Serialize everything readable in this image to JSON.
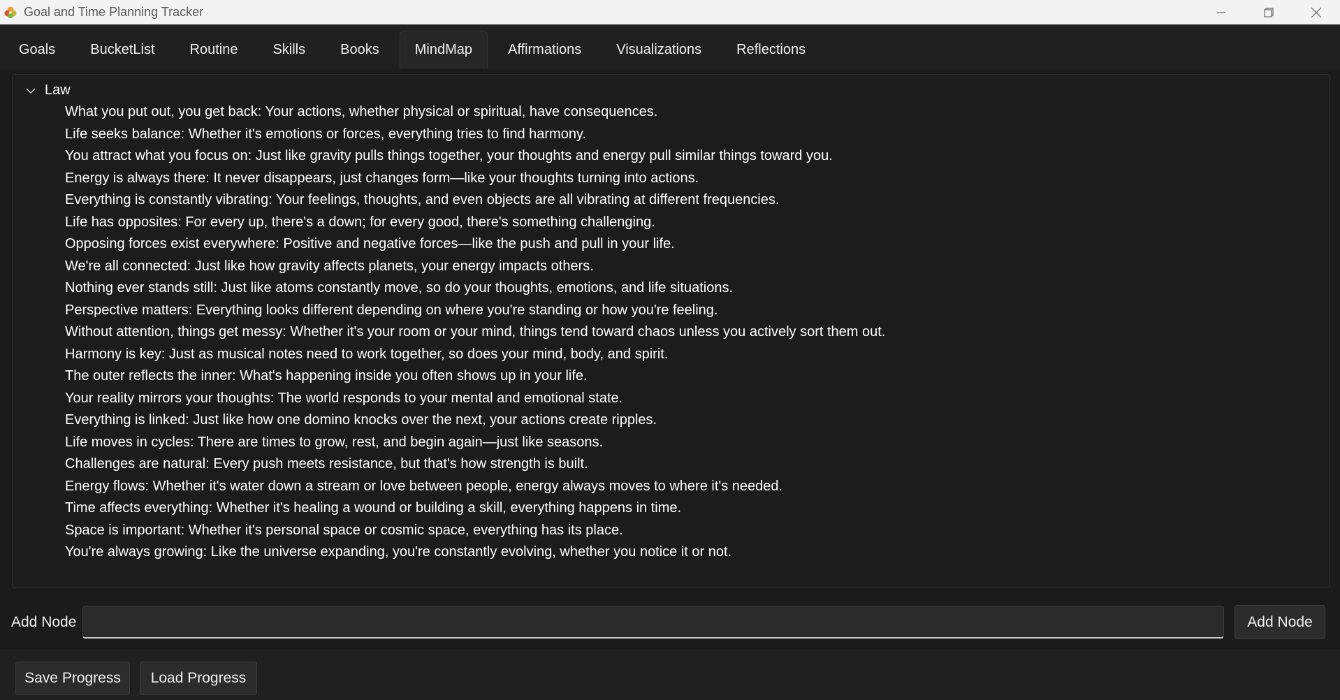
{
  "window": {
    "title": "Goal and Time Planning Tracker",
    "app_icon": "flower-logo-icon",
    "controls": [
      "minimize-icon",
      "restore-icon",
      "close-icon"
    ]
  },
  "tabs": [
    {
      "label": "Goals",
      "active": false
    },
    {
      "label": "BucketList",
      "active": false
    },
    {
      "label": "Routine",
      "active": false
    },
    {
      "label": "Skills",
      "active": false
    },
    {
      "label": "Books",
      "active": false
    },
    {
      "label": "MindMap",
      "active": true
    },
    {
      "label": "Affirmations",
      "active": false
    },
    {
      "label": "Visualizations",
      "active": false
    },
    {
      "label": "Reflections",
      "active": false
    }
  ],
  "mindmap": {
    "root": {
      "label": "Law",
      "expanded": true,
      "children": [
        "What you put out, you get back: Your actions, whether physical or spiritual, have consequences.",
        "Life seeks balance: Whether it's emotions or forces, everything tries to find harmony.",
        "You attract what you focus on: Just like gravity pulls things together, your thoughts and energy pull similar things toward you.",
        "Energy is always there: It never disappears, just changes form—like your thoughts turning into actions.",
        "Everything is constantly vibrating: Your feelings, thoughts, and even objects are all vibrating at different frequencies.",
        "Life has opposites: For every up, there's a down; for every good, there's something challenging.",
        "Opposing forces exist everywhere: Positive and negative forces—like the push and pull in your life.",
        "We're all connected: Just like how gravity affects planets, your energy impacts others.",
        "Nothing ever stands still: Just like atoms constantly move, so do your thoughts, emotions, and life situations.",
        "Perspective matters: Everything looks different depending on where you're standing or how you're feeling.",
        "Without attention, things get messy: Whether it's your room or your mind, things tend toward chaos unless you actively sort them out.",
        "Harmony is key: Just as musical notes need to work together, so does your mind, body, and spirit.",
        "The outer reflects the inner: What's happening inside you often shows up in your life.",
        "Your reality mirrors your thoughts: The world responds to your mental and emotional state.",
        "Everything is linked: Just like how one domino knocks over the next, your actions create ripples.",
        "Life moves in cycles: There are times to grow, rest, and begin again—just like seasons.",
        "Challenges are natural: Every push meets resistance, but that's how strength is built.",
        "Energy flows: Whether it's water down a stream or love between people, energy always moves to where it's needed.",
        "Time affects everything: Whether it's healing a wound or building a skill, everything happens in time.",
        "Space is important: Whether it's personal space or cosmic space, everything has its place.",
        "You're always growing: Like the universe expanding, you're constantly evolving, whether you notice it or not."
      ]
    }
  },
  "add_node": {
    "label": "Add Node",
    "input_value": "",
    "button_label": "Add Node"
  },
  "footer": {
    "save_label": "Save Progress",
    "load_label": "Load Progress"
  }
}
